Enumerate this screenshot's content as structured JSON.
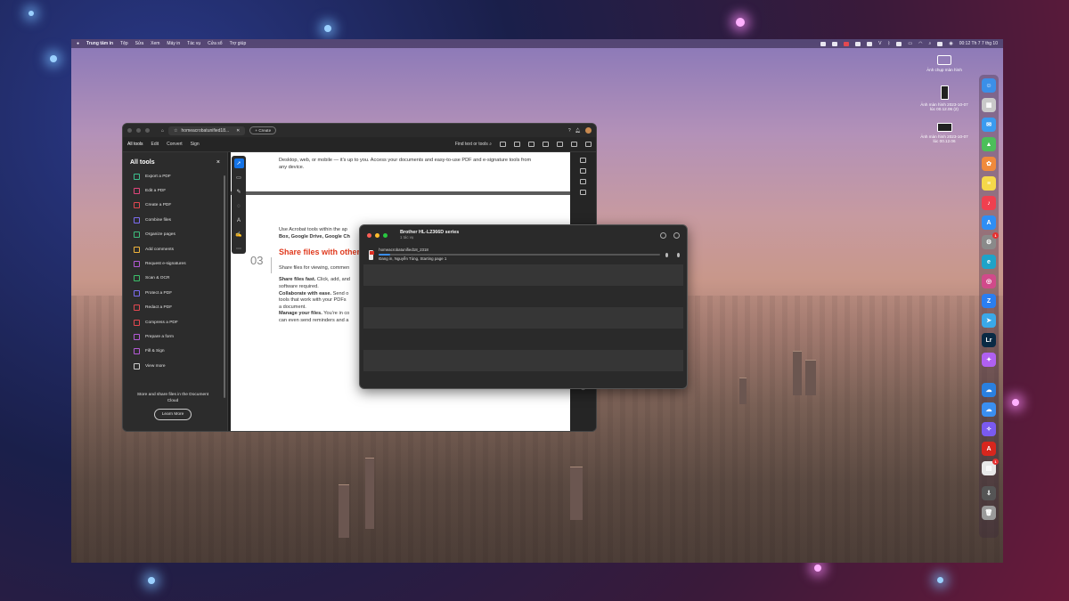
{
  "menubar": {
    "app": "Trung tâm in",
    "menus": [
      "Tệp",
      "Sửa",
      "Xem",
      "Máy in",
      "Tác vụ",
      "Cửa sổ",
      "Trợ giúp"
    ],
    "clock": "00:12 Th 7 7 thg 10"
  },
  "desktop": {
    "items": [
      {
        "label": "Ảnh chụp màn hình",
        "icon": "screenshot-folder-icon"
      },
      {
        "label": "Ảnh màn hình 2023-10-07 lúc 00.12.06 (2)",
        "icon": "screenshot-thumbnail-icon"
      },
      {
        "label": "Ảnh màn hình 2023-10-07 lúc 00.12.06",
        "icon": "screenshot-thumbnail-icon"
      }
    ]
  },
  "acrobat": {
    "tab_title": "homeacrobatunified18...",
    "create_label": "+ Create",
    "toolbar": {
      "items": [
        "All tools",
        "Edit",
        "Convert",
        "Sign"
      ],
      "find_label": "Find text or tools"
    },
    "sidebar": {
      "title": "All tools",
      "close": "×",
      "items": [
        {
          "label": "Export a PDF",
          "color": "#3dbf8e"
        },
        {
          "label": "Edit a PDF",
          "color": "#e0457b"
        },
        {
          "label": "Create a PDF",
          "color": "#e34850"
        },
        {
          "label": "Combine files",
          "color": "#7c6df0"
        },
        {
          "label": "Organize pages",
          "color": "#3ebd7c"
        },
        {
          "label": "Add comments",
          "color": "#f0b43c"
        },
        {
          "label": "Request e-signatures",
          "color": "#b45ad6"
        },
        {
          "label": "Scan & OCR",
          "color": "#3cbf6a"
        },
        {
          "label": "Protect a PDF",
          "color": "#7c6df0"
        },
        {
          "label": "Redact a PDF",
          "color": "#e34850"
        },
        {
          "label": "Compress a PDF",
          "color": "#e34850"
        },
        {
          "label": "Prepare a form",
          "color": "#b45ad6"
        },
        {
          "label": "Fill & Sign",
          "color": "#b45ad6"
        },
        {
          "label": "View more",
          "color": "#cccccc"
        }
      ],
      "footer_text": "Store and share files in the Document Cloud",
      "footer_button": "Learn More"
    },
    "document": {
      "top_text": "Desktop, web, or mobile — it’s up to you. Access your documents and easy-to-use PDF and e-signature tools from any device.",
      "para2a": "Use Acrobat tools within the ap",
      "para2b": "Box, Google Drive, Google Ch",
      "section_num": "03",
      "section_title": "Share files with others",
      "intro": "Share files for viewing, commen",
      "b1_bold": "Share files fast.",
      "b1_text": " Click, add, and",
      "b1_line2": "software required.",
      "b2_bold": "Collaborate with ease.",
      "b2_text": " Send o",
      "b2_line2": "tools that work with your PDFs",
      "b2_line3": "a document.",
      "b3_bold": "Manage your files.",
      "b3_text": " You’re in co",
      "b3_line2": "can even send reminders and a"
    }
  },
  "print_queue": {
    "printer_name": "Brother HL-L2366D series",
    "subtitle": "1 tác vụ",
    "job": {
      "filename": "homeacrobatunified18_2318",
      "status": "Đang in, Nguyễn Tùng, Starting page 1",
      "progress": 0.04
    }
  },
  "dock": {
    "apps": [
      {
        "name": "finder-icon",
        "color": "#3b8fe8",
        "glyph": "☺"
      },
      {
        "name": "launchpad-icon",
        "color": "#c9c9c9",
        "glyph": "▦"
      },
      {
        "name": "mail-icon",
        "color": "#3a9bf0",
        "glyph": "✉"
      },
      {
        "name": "maps-icon",
        "color": "#4cbf5a",
        "glyph": "▲"
      },
      {
        "name": "photos-icon",
        "color": "#f08a3c",
        "glyph": "✿"
      },
      {
        "name": "notes-icon",
        "color": "#f5d84a",
        "glyph": "≡"
      },
      {
        "name": "music-icon",
        "color": "#f0404f",
        "glyph": "♪"
      },
      {
        "name": "app-store-icon",
        "color": "#2e8ef5",
        "glyph": "A"
      },
      {
        "name": "system-settings-icon",
        "color": "#8a8a8a",
        "glyph": "⚙",
        "badge": "1"
      },
      {
        "name": "edge-icon",
        "color": "#1fa3c8",
        "glyph": "e"
      },
      {
        "name": "creative-cloud-icon",
        "color": "#d14a8a",
        "glyph": "◎"
      },
      {
        "name": "zalo-icon",
        "color": "#2a7ef0",
        "glyph": "Z"
      },
      {
        "name": "telegram-icon",
        "color": "#3aa8e8",
        "glyph": "➤"
      },
      {
        "name": "lightroom-icon",
        "color": "#0a2a44",
        "glyph": "Lr"
      },
      {
        "name": "messenger-icon",
        "color": "#b060f0",
        "glyph": "✦"
      },
      {
        "name": "onedrive-icon",
        "color": "#2a80e0",
        "glyph": "☁"
      },
      {
        "name": "icloud-drive-icon",
        "color": "#3a8ff0",
        "glyph": "☁"
      },
      {
        "name": "messenger-fb-icon",
        "color": "#7a5af0",
        "glyph": "✧"
      },
      {
        "name": "acrobat-icon",
        "color": "#d8261d",
        "glyph": "A"
      },
      {
        "name": "printer-icon",
        "color": "#e8e8e8",
        "glyph": "▤",
        "badge": "1"
      },
      {
        "name": "downloads-stack-icon",
        "color": "#555555",
        "glyph": "⇩"
      },
      {
        "name": "trash-icon",
        "color": "#9a9a9a",
        "glyph": "🗑"
      }
    ]
  }
}
